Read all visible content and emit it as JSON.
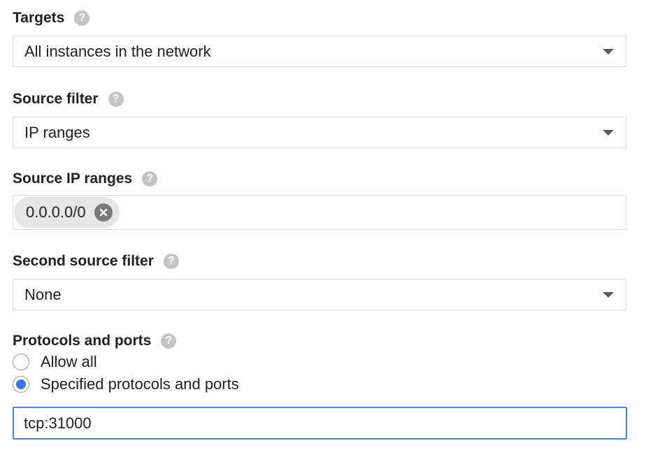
{
  "targets": {
    "label": "Targets",
    "help_glyph": "?",
    "value": "All instances in the network"
  },
  "source_filter": {
    "label": "Source filter",
    "help_glyph": "?",
    "value": "IP ranges"
  },
  "source_ip_ranges": {
    "label": "Source IP ranges",
    "help_glyph": "?",
    "chips": [
      "0.0.0.0/0"
    ]
  },
  "second_source_filter": {
    "label": "Second source filter",
    "help_glyph": "?",
    "value": "None"
  },
  "protocols_and_ports": {
    "label": "Protocols and ports",
    "help_glyph": "?",
    "options": [
      {
        "label": "Allow all",
        "checked": false
      },
      {
        "label": "Specified protocols and ports",
        "checked": true
      }
    ],
    "input_value": "tcp:31000"
  },
  "colors": {
    "accent": "#3b78e7",
    "focus_border": "#4a86e8",
    "help_icon": "#c4c4c4"
  },
  "icons": {
    "help": "help-icon",
    "dropdown": "caret-down-icon",
    "chip_remove": "close-circle-icon"
  }
}
